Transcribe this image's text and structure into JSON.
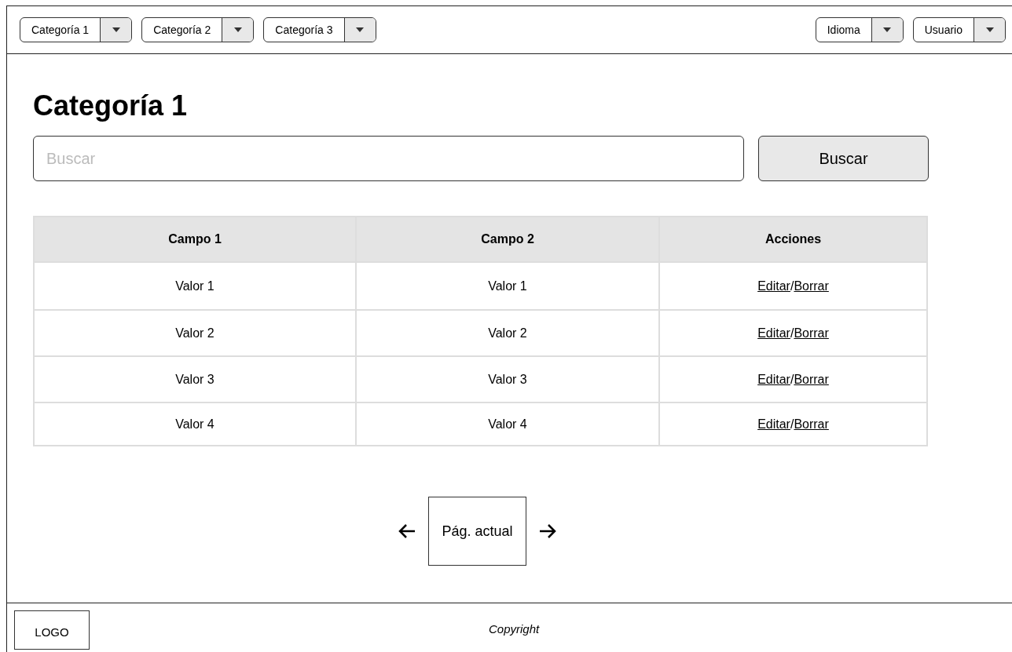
{
  "nav": {
    "left": [
      {
        "label": "Categoría 1"
      },
      {
        "label": "Categoría 2"
      },
      {
        "label": "Categoría 3"
      }
    ],
    "right": [
      {
        "label": "Idioma"
      },
      {
        "label": "Usuario"
      }
    ]
  },
  "heading": "Categoría 1",
  "search": {
    "placeholder": "Buscar",
    "button": "Buscar"
  },
  "table": {
    "columns": [
      "Campo 1",
      "Campo 2",
      "Acciones"
    ],
    "rows": [
      {
        "cells": [
          "Valor 1",
          "Valor 1"
        ],
        "actions": [
          "Editar",
          "Borrar"
        ]
      },
      {
        "cells": [
          "Valor 2",
          "Valor 2"
        ],
        "actions": [
          "Editar",
          "Borrar"
        ]
      },
      {
        "cells": [
          "Valor 3",
          "Valor 3"
        ],
        "actions": [
          "Editar",
          "Borrar"
        ]
      },
      {
        "cells": [
          "Valor 4",
          "Valor 4"
        ],
        "actions": [
          "Editar",
          "Borrar"
        ]
      }
    ],
    "action_separator": "/"
  },
  "pagination": {
    "current": "Pág. actual"
  },
  "footer": {
    "logo": "LOGO",
    "copyright": "Copyright"
  }
}
